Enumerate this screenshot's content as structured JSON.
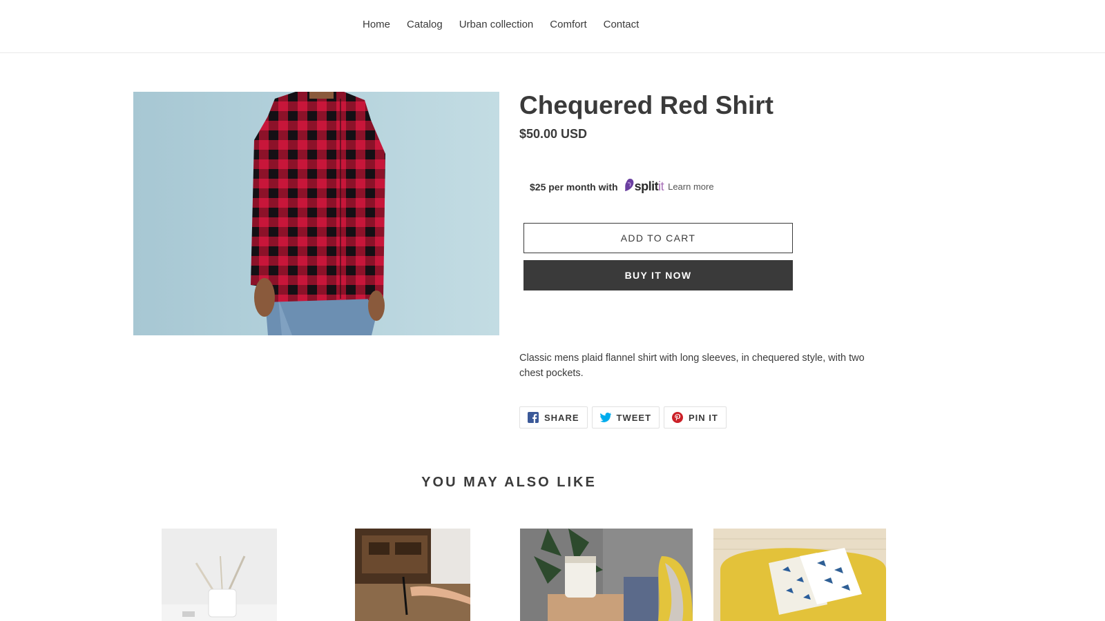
{
  "nav": {
    "items": [
      "Home",
      "Catalog",
      "Urban collection",
      "Comfort",
      "Contact"
    ]
  },
  "product": {
    "title": "Chequered Red Shirt",
    "price": "$50.00 USD",
    "splitit": {
      "amount_text": "$25 per month with",
      "logo_main": "split",
      "logo_suffix": "it",
      "learn_more": "Learn more"
    },
    "add_to_cart": "ADD TO CART",
    "buy_now": "BUY IT NOW",
    "description": "Classic mens plaid flannel shirt with long sleeves, in chequered style, with two chest pockets."
  },
  "share": {
    "facebook": "SHARE",
    "twitter": "TWEET",
    "pinterest": "PIN IT"
  },
  "related": {
    "heading": "YOU MAY ALSO LIKE"
  },
  "colors": {
    "text": "#3a3a3a",
    "button_dark": "#3a3a3a",
    "facebook": "#3b5998",
    "twitter": "#00aced",
    "pinterest": "#cb2027",
    "splitit_purple": "#6a3fa0"
  },
  "icons": [
    "facebook-icon",
    "twitter-icon",
    "pinterest-icon",
    "splitit-logo-icon"
  ]
}
